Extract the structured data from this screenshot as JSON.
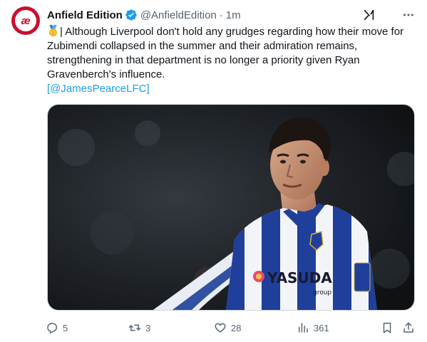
{
  "tweet": {
    "author": {
      "display_name": "Anfield Edition",
      "handle": "@AnfieldEdition",
      "separator": "·",
      "time": "1m",
      "avatar_text": "æ",
      "verified": true
    },
    "text": {
      "line1_prefix": "| Although Liverpool don't hold any grudges regarding how their move for",
      "line2": "Zubimendi collapsed in the summer and their admiration remains,",
      "line3": "strengthening in that department is no longer a priority given Ryan",
      "line4": "Gravenberch's influence.",
      "mention_open": "[",
      "mention": "@JamesPearceLFC",
      "mention_close": "]"
    },
    "media": {
      "shirt_sponsor": "YASUDA",
      "sponsor_sub": "group"
    },
    "actions": {
      "replies": "5",
      "retweets": "3",
      "likes": "28",
      "views": "361"
    }
  },
  "colors": {
    "accent": "#1d9bf0",
    "brand": "#c8102e",
    "muted": "#536471"
  },
  "icons": {
    "verified": "verified-badge-icon",
    "grok": "grok-icon",
    "more": "more-icon",
    "medal": "medal-emoji-icon",
    "reply": "reply-icon",
    "retweet": "retweet-icon",
    "like": "heart-icon",
    "views": "views-icon",
    "bookmark": "bookmark-icon",
    "share": "share-icon"
  }
}
